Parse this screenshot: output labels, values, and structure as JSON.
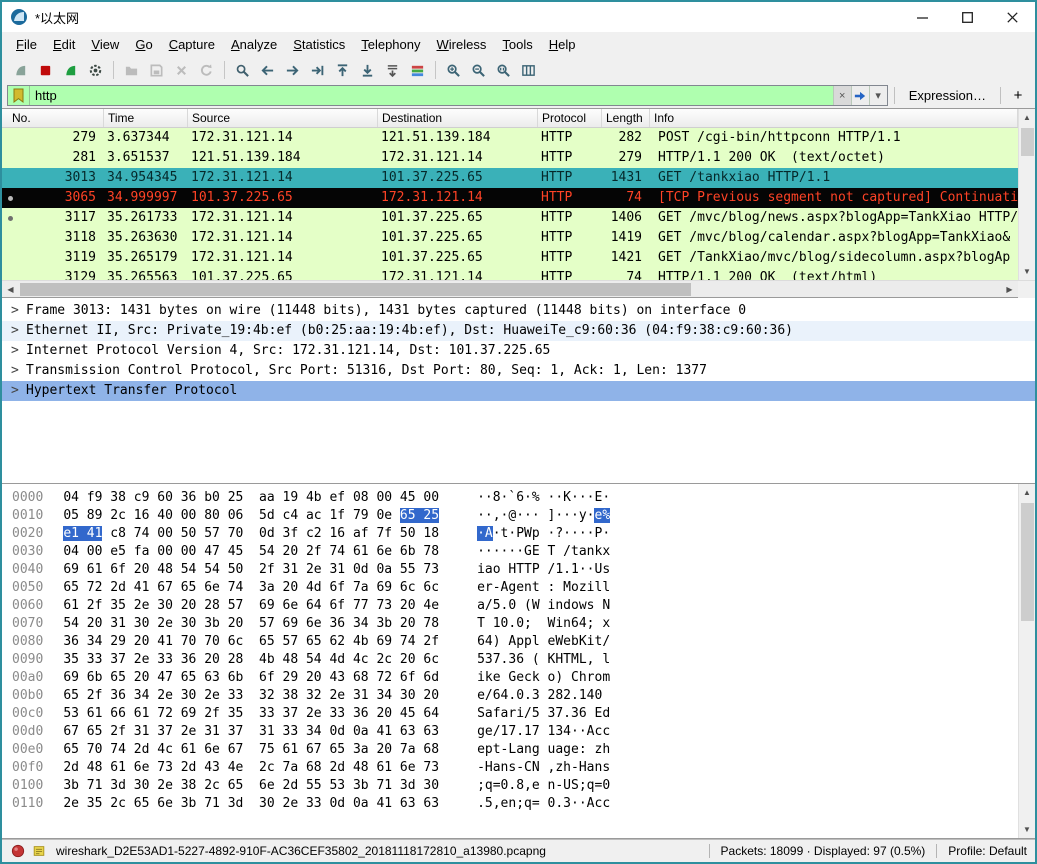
{
  "window": {
    "title": "*以太网"
  },
  "menu": {
    "items": [
      "File",
      "Edit",
      "View",
      "Go",
      "Capture",
      "Analyze",
      "Statistics",
      "Telephony",
      "Wireless",
      "Tools",
      "Help"
    ]
  },
  "toolbar": {
    "items": [
      {
        "name": "capture-start-icon",
        "kind": "fin",
        "color": "#89a399",
        "disabled": true
      },
      {
        "name": "capture-stop-icon",
        "kind": "square",
        "color": "#c00a0a",
        "disabled": false
      },
      {
        "name": "capture-restart-icon",
        "kind": "fin",
        "color": "#1e9e40",
        "disabled": false
      },
      {
        "name": "capture-options-icon",
        "kind": "gear",
        "color": "#3d4a45",
        "disabled": false
      },
      {
        "sep": true
      },
      {
        "name": "open-file-icon",
        "kind": "folder",
        "color": "#bcbcbc",
        "disabled": true
      },
      {
        "name": "save-file-icon",
        "kind": "floppy",
        "color": "#bcbcbc",
        "disabled": true
      },
      {
        "name": "close-file-icon",
        "kind": "close",
        "color": "#bcbcbc",
        "disabled": true
      },
      {
        "name": "reload-file-icon",
        "kind": "reload",
        "color": "#bcbcbc",
        "disabled": true
      },
      {
        "sep": true
      },
      {
        "name": "find-packet-icon",
        "kind": "find",
        "color": "#40606e",
        "disabled": false
      },
      {
        "name": "go-back-icon",
        "kind": "arrow-left",
        "color": "#3c6475",
        "disabled": false
      },
      {
        "name": "go-forward-icon",
        "kind": "arrow-right",
        "color": "#3c6475",
        "disabled": false
      },
      {
        "name": "go-to-packet-icon",
        "kind": "goto",
        "color": "#3c6475",
        "disabled": false
      },
      {
        "name": "first-packet-icon",
        "kind": "arrow-top",
        "color": "#3c6475",
        "disabled": false
      },
      {
        "name": "last-packet-icon",
        "kind": "arrow-bottom",
        "color": "#3c6475",
        "disabled": false
      },
      {
        "name": "auto-scroll-icon",
        "kind": "autoscroll",
        "color": "#555555",
        "disabled": false
      },
      {
        "name": "colorize-icon",
        "kind": "colorize",
        "color": "#555555",
        "disabled": false
      },
      {
        "sep": true
      },
      {
        "name": "zoom-in-icon",
        "kind": "zoom-in",
        "color": "#3c6475",
        "disabled": false
      },
      {
        "name": "zoom-out-icon",
        "kind": "zoom-out",
        "color": "#3c6475",
        "disabled": false
      },
      {
        "name": "zoom-original-icon",
        "kind": "zoom-orig",
        "color": "#3c6475",
        "disabled": false
      },
      {
        "name": "resize-columns-icon",
        "kind": "columns",
        "color": "#3c6475",
        "disabled": false
      }
    ]
  },
  "filter": {
    "value": "http",
    "expression_label": "Expression…",
    "add_label": "+"
  },
  "packet_list": {
    "columns": [
      "No.",
      "Time",
      "Source",
      "Destination",
      "Protocol",
      "Length",
      "Info"
    ],
    "rows": [
      {
        "no": "279",
        "time": "3.637344",
        "source": "172.31.121.14",
        "destination": "121.51.139.184",
        "protocol": "HTTP",
        "length": "282",
        "info": "POST /cgi-bin/httpconn HTTP/1.1",
        "style": "http",
        "marker": false
      },
      {
        "no": "281",
        "time": "3.651537",
        "source": "121.51.139.184",
        "destination": "172.31.121.14",
        "protocol": "HTTP",
        "length": "279",
        "info": "HTTP/1.1 200 OK  (text/octet)",
        "style": "http",
        "marker": false
      },
      {
        "no": "3013",
        "time": "34.954345",
        "source": "172.31.121.14",
        "destination": "101.37.225.65",
        "protocol": "HTTP",
        "length": "1431",
        "info": "GET /tankxiao HTTP/1.1",
        "style": "selected",
        "marker": false
      },
      {
        "no": "3065",
        "time": "34.999997",
        "source": "101.37.225.65",
        "destination": "172.31.121.14",
        "protocol": "HTTP",
        "length": "74",
        "info": "[TCP Previous segment not captured] Continuati",
        "style": "bad-tcp",
        "marker": true
      },
      {
        "no": "3117",
        "time": "35.261733",
        "source": "172.31.121.14",
        "destination": "101.37.225.65",
        "protocol": "HTTP",
        "length": "1406",
        "info": "GET /mvc/blog/news.aspx?blogApp=TankXiao HTTP/",
        "style": "http",
        "marker": true
      },
      {
        "no": "3118",
        "time": "35.263630",
        "source": "172.31.121.14",
        "destination": "101.37.225.65",
        "protocol": "HTTP",
        "length": "1419",
        "info": "GET /mvc/blog/calendar.aspx?blogApp=TankXiao&",
        "style": "http",
        "marker": false
      },
      {
        "no": "3119",
        "time": "35.265179",
        "source": "172.31.121.14",
        "destination": "101.37.225.65",
        "protocol": "HTTP",
        "length": "1421",
        "info": "GET /TankXiao/mvc/blog/sidecolumn.aspx?blogAp",
        "style": "http",
        "marker": false
      },
      {
        "no": "3129",
        "time": "35.265563",
        "source": "101.37.225.65",
        "destination": "172.31.121.14",
        "protocol": "HTTP",
        "length": "74",
        "info": "HTTP/1.1 200 OK  (text/html)",
        "style": "http",
        "marker": false
      }
    ]
  },
  "details": {
    "rows": [
      {
        "text": "Frame 3013: 1431 bytes on wire (11448 bits), 1431 bytes captured (11448 bits) on interface 0",
        "tint": false,
        "selected": false
      },
      {
        "text": "Ethernet II, Src: Private_19:4b:ef (b0:25:aa:19:4b:ef), Dst: HuaweiTe_c9:60:36 (04:f9:38:c9:60:36)",
        "tint": true,
        "selected": false
      },
      {
        "text": "Internet Protocol Version 4, Src: 172.31.121.14, Dst: 101.37.225.65",
        "tint": false,
        "selected": false
      },
      {
        "text": "Transmission Control Protocol, Src Port: 51316, Dst Port: 80, Seq: 1, Ack: 1, Len: 1377",
        "tint": false,
        "selected": false
      },
      {
        "text": "Hypertext Transfer Protocol",
        "tint": false,
        "selected": true
      }
    ]
  },
  "hex_dump": {
    "lines": [
      {
        "offset": "0000",
        "hex": "04 f9 38 c9 60 36 b0 25 aa 19 4b ef 08 00 45 00",
        "ascii": "··8·`6·%··K···E·"
      },
      {
        "offset": "0010",
        "hex": "05 89 2c 16 40 00 80 06 5d c4 ac 1f 79 0e 65 25",
        "ascii": "··,·@···]···y·e%"
      },
      {
        "offset": "0020",
        "hex": "e1 41 c8 74 00 50 57 70 0d 3f c2 16 af 7f 50 18",
        "ascii": "·A·t·PWp·?····P·"
      },
      {
        "offset": "0030",
        "hex": "04 00 e5 fa 00 00 47 45 54 20 2f 74 61 6e 6b 78",
        "ascii": "······GET /tankx"
      },
      {
        "offset": "0040",
        "hex": "69 61 6f 20 48 54 54 50 2f 31 2e 31 0d 0a 55 73",
        "ascii": "iao HTTP/1.1··Us"
      },
      {
        "offset": "0050",
        "hex": "65 72 2d 41 67 65 6e 74 3a 20 4d 6f 7a 69 6c 6c",
        "ascii": "er-Agent: Mozill"
      },
      {
        "offset": "0060",
        "hex": "61 2f 35 2e 30 20 28 57 69 6e 64 6f 77 73 20 4e",
        "ascii": "a/5.0 (Windows N"
      },
      {
        "offset": "0070",
        "hex": "54 20 31 30 2e 30 3b 20 57 69 6e 36 34 3b 20 78",
        "ascii": "T 10.0; Win64; x"
      },
      {
        "offset": "0080",
        "hex": "36 34 29 20 41 70 70 6c 65 57 65 62 4b 69 74 2f",
        "ascii": "64) AppleWebKit/"
      },
      {
        "offset": "0090",
        "hex": "35 33 37 2e 33 36 20 28 4b 48 54 4d 4c 2c 20 6c",
        "ascii": "537.36 (KHTML, l"
      },
      {
        "offset": "00a0",
        "hex": "69 6b 65 20 47 65 63 6b 6f 29 20 43 68 72 6f 6d",
        "ascii": "ike Gecko) Chrom"
      },
      {
        "offset": "00b0",
        "hex": "65 2f 36 34 2e 30 2e 33 32 38 32 2e 31 34 30 20",
        "ascii": "e/64.0.3282.140 "
      },
      {
        "offset": "00c0",
        "hex": "53 61 66 61 72 69 2f 35 33 37 2e 33 36 20 45 64",
        "ascii": "Safari/537.36 Ed"
      },
      {
        "offset": "00d0",
        "hex": "67 65 2f 31 37 2e 31 37 31 33 34 0d 0a 41 63 63",
        "ascii": "ge/17.17134··Acc"
      },
      {
        "offset": "00e0",
        "hex": "65 70 74 2d 4c 61 6e 67 75 61 67 65 3a 20 7a 68",
        "ascii": "ept-Language: zh"
      },
      {
        "offset": "00f0",
        "hex": "2d 48 61 6e 73 2d 43 4e 2c 7a 68 2d 48 61 6e 73",
        "ascii": "-Hans-CN,zh-Hans"
      },
      {
        "offset": "0100",
        "hex": "3b 71 3d 30 2e 38 2c 65 6e 2d 55 53 3b 71 3d 30",
        "ascii": ";q=0.8,en-US;q=0"
      },
      {
        "offset": "0110",
        "hex": "2e 35 2c 65 6e 3b 71 3d 30 2e 33 0d 0a 41 63 63",
        "ascii": ".5,en;q=0.3··Acc"
      }
    ],
    "highlight": [
      {
        "line": 1,
        "start": 14,
        "end": 15
      },
      {
        "line": 2,
        "start": 0,
        "end": 1
      }
    ]
  },
  "status_bar": {
    "file": "wireshark_D2E53AD1-5227-4892-910F-AC36CEF35802_20181118172810_a13980.pcapng",
    "packets": "Packets: 18099 · Displayed: 97 (0.5%)",
    "profile": "Profile: Default"
  },
  "colors": {
    "accent_border": "#2e8f9e",
    "filter_valid_bg": "#afffaf",
    "http_row_bg": "#e4ffc7",
    "selected_row_bg": "#3ab1b8",
    "bad_tcp_bg": "#050505",
    "bad_tcp_text": "#ff4326",
    "details_selected_bg": "#8fb3e8",
    "hex_highlight_bg": "#3268cc"
  }
}
